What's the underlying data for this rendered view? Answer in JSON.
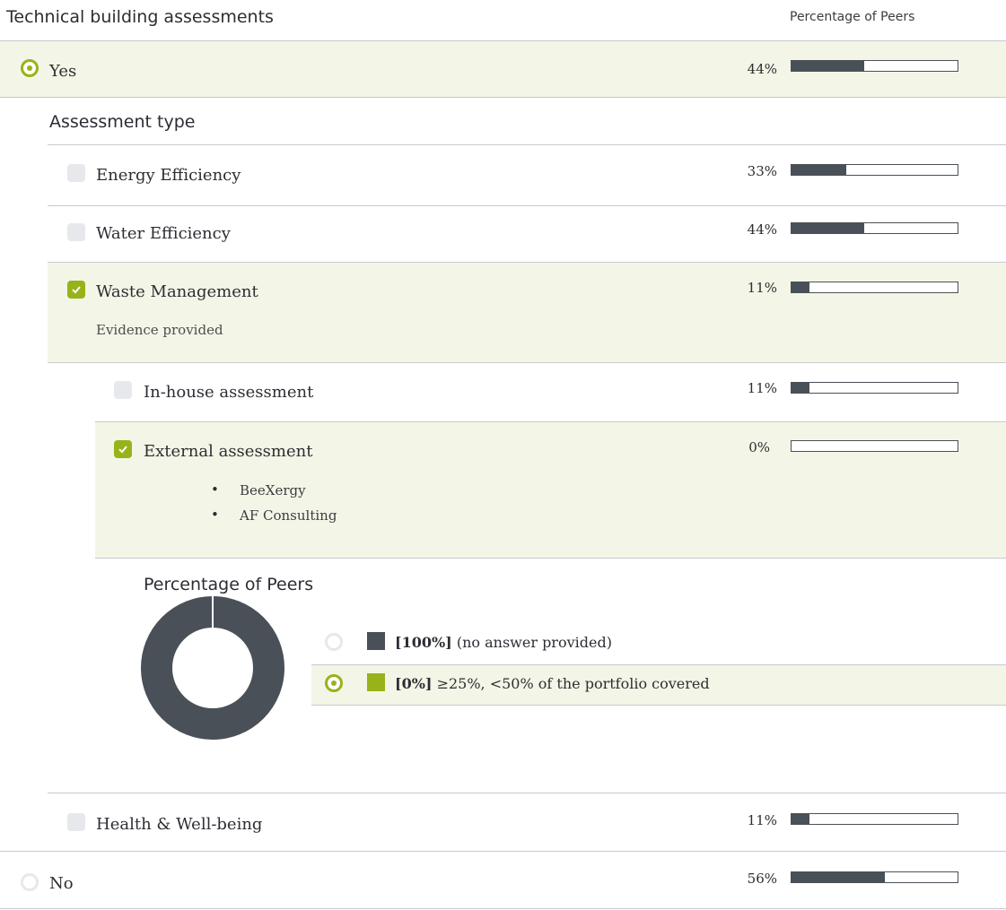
{
  "header": {
    "title": "Technical building assessments",
    "peers_label": "Percentage of Peers"
  },
  "options": {
    "yes": {
      "label": "Yes",
      "pct": "44%",
      "fill": 0.44,
      "selected": true
    },
    "no": {
      "label": "No",
      "pct": "56%",
      "fill": 0.56,
      "selected": false
    }
  },
  "assessment": {
    "title": "Assessment type",
    "items": [
      {
        "label": "Energy Efficiency",
        "pct": "33%",
        "fill": 0.33,
        "checked": false
      },
      {
        "label": "Water Efficiency",
        "pct": "44%",
        "fill": 0.44,
        "checked": false
      },
      {
        "label": "Waste Management",
        "pct": "11%",
        "fill": 0.11,
        "checked": true,
        "note": "Evidence provided"
      },
      {
        "label": "Health & Well-being",
        "pct": "11%",
        "fill": 0.11,
        "checked": false
      }
    ],
    "sub": [
      {
        "label": "In-house assessment",
        "pct": "11%",
        "fill": 0.11,
        "checked": false
      },
      {
        "label": "External assessment",
        "pct": "0%",
        "fill": 0,
        "checked": true,
        "bullets": [
          "BeeXergy",
          "AF Consulting"
        ]
      }
    ]
  },
  "peers_chart": {
    "title": "Percentage of Peers",
    "legend": [
      {
        "value": "[100%]",
        "text": "(no answer provided)",
        "color": "#4a5057",
        "selected": false
      },
      {
        "value": "[0%]",
        "text": "≥25%, <50% of the portfolio covered",
        "color": "#97b31a",
        "selected": true
      }
    ]
  },
  "chart_data": {
    "type": "pie",
    "title": "Percentage of Peers",
    "labels": [
      "(no answer provided)",
      "≥25%, <50% of the portfolio covered"
    ],
    "values": [
      100,
      0
    ],
    "colors": [
      "#4a5057",
      "#97b31a"
    ]
  }
}
